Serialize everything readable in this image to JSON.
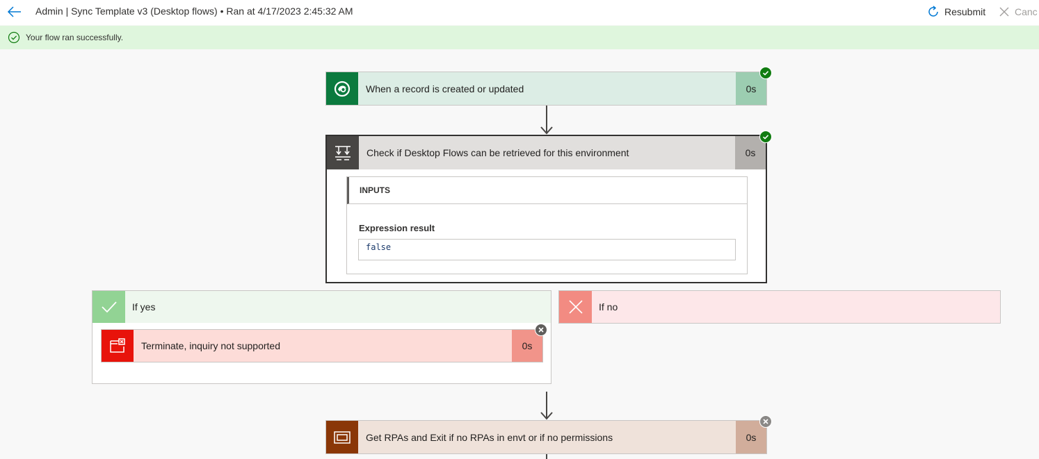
{
  "header": {
    "title": "Admin | Sync Template v3 (Desktop flows) • Ran at 4/17/2023 2:45:32 AM",
    "resubmit_label": "Resubmit",
    "cancel_label": "Canc"
  },
  "banner": {
    "message": "Your flow ran successfully."
  },
  "colors": {
    "success": "#107c10",
    "banner_bg": "#dff6dd",
    "accent": "#0078d4",
    "failed_status": "#605e5c"
  },
  "steps": {
    "trigger": {
      "title": "When a record is created or updated",
      "duration": "0s",
      "icon": "dataverse-icon",
      "status": "succeeded"
    },
    "condition": {
      "title": "Check if Desktop Flows can be retrieved for this environment",
      "duration": "0s",
      "icon": "condition-icon",
      "status": "succeeded",
      "inputs_header": "INPUTS",
      "expression_label": "Expression result",
      "expression_value": "false"
    },
    "if_yes": {
      "label": "If yes",
      "icon": "check-icon"
    },
    "if_no": {
      "label": "If no",
      "icon": "x-icon"
    },
    "terminate": {
      "title": "Terminate, inquiry not supported",
      "duration": "0s",
      "icon": "terminate-icon",
      "status": "skipped"
    },
    "get_rpas": {
      "title": "Get RPAs and Exit if no RPAs in envt or if no permissions",
      "duration": "0s",
      "icon": "scope-icon",
      "status": "skipped"
    }
  }
}
